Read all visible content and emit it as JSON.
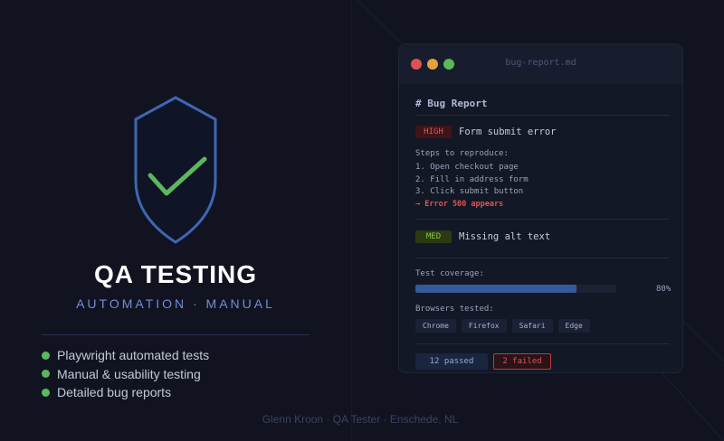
{
  "hero": {
    "title": "QA TESTING",
    "subtitle": "AUTOMATION · MANUAL",
    "features": [
      "Playwright automated tests",
      "Manual & usability testing",
      "Detailed bug reports"
    ],
    "footer": "Glenn Kroon · QA Tester · Enschede, NL",
    "shield_icon": "shield-check-icon"
  },
  "window": {
    "title": "bug-report.md",
    "doc_heading": "# Bug Report",
    "issues": [
      {
        "severity": "HIGH",
        "text": "Form submit error"
      },
      {
        "severity": "MED",
        "text": "Missing alt text"
      }
    ],
    "steps_label": "Steps to reproduce:",
    "steps": [
      "1. Open checkout page",
      "2. Fill in address form",
      "3. Click submit button"
    ],
    "result": "→ Error 500 appears",
    "coverage_label": "Test coverage:",
    "coverage_percent": 80,
    "coverage_text": "80%",
    "browsers_label": "Browsers tested:",
    "browsers": [
      "Chrome",
      "Firefox",
      "Safari",
      "Edge"
    ],
    "passed": "12 passed",
    "failed": "2 failed"
  },
  "colors": {
    "background": "#111420",
    "accent_blue": "#6f8ed8",
    "success_green": "#5cb85c",
    "error_red": "#e05252"
  }
}
